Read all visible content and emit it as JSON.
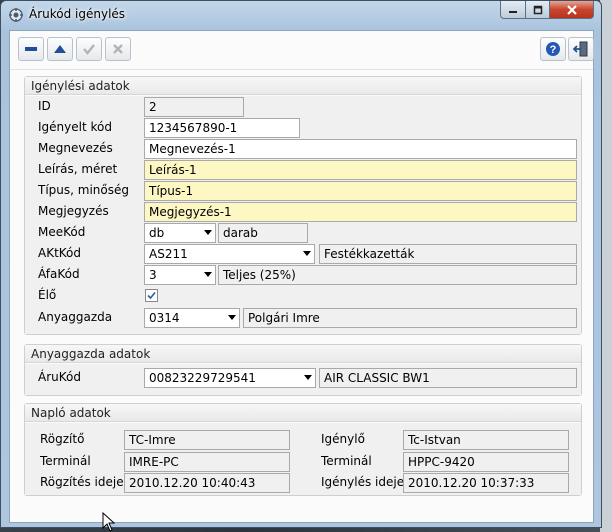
{
  "window": {
    "title": "Árukód igénylés"
  },
  "toolbar": {
    "buttons": [
      "remove",
      "up",
      "confirm",
      "cancel",
      "help",
      "exit"
    ]
  },
  "sections": {
    "igenylesi": "Igénylési adatok",
    "anyaggazda": "Anyaggazda adatok",
    "naplo": "Napló adatok"
  },
  "form": {
    "id_label": "ID",
    "id_value": "2",
    "igenyelt_kod_label": "Igényelt kód",
    "igenyelt_kod_value": "1234567890-1",
    "megnevezes_label": "Megnevezés",
    "megnevezes_value": "Megnevezés-1",
    "leiras_label": "Leírás, méret",
    "leiras_value": "Leírás-1",
    "tipus_label": "Típus, minőség",
    "tipus_value": "Típus-1",
    "megjegyzes_label": "Megjegyzés",
    "megjegyzes_value": "Megjegyzés-1",
    "meekod_label": "MeeKód",
    "meekod_value": "db",
    "meekod_desc": "darab",
    "aktkod_label": "AKtKód",
    "aktkod_value": "AS211",
    "aktkod_desc": "Festékkazetták",
    "afakod_label": "ÁfaKód",
    "afakod_value": "3",
    "afakod_desc": "Teljes (25%)",
    "elo_label": "Élő",
    "elo_checked": true,
    "anyaggazda_label": "Anyaggazda",
    "anyaggazda_value": "0314",
    "anyaggazda_desc": "Polgári Imre"
  },
  "anyaggazda": {
    "arukod_label": "ÁruKód",
    "arukod_value": "00823229729541",
    "arukod_desc": "AIR CLASSIC BW1"
  },
  "naplo": {
    "rogzito_label": "Rögzítő",
    "rogzito_value": "TC-Imre",
    "terminal1_label": "Terminál",
    "terminal1_value": "IMRE-PC",
    "rogzites_ideje_label": "Rögzítés ideje",
    "rogzites_ideje_value": "2010.12.20 10:40:43",
    "igenylo_label": "Igénylő",
    "igenylo_value": "Tc-Istvan",
    "terminal2_label": "Terminál",
    "terminal2_value": "HPPC-9420",
    "igenyles_ideje_label": "Igénylés ideje",
    "igenyles_ideje_value": "2010.12.20 10:37:33"
  },
  "colors": {
    "required_field": "#fdf7c4",
    "readonly_field": "#f0f0f0",
    "close_button": "#c8452e"
  }
}
